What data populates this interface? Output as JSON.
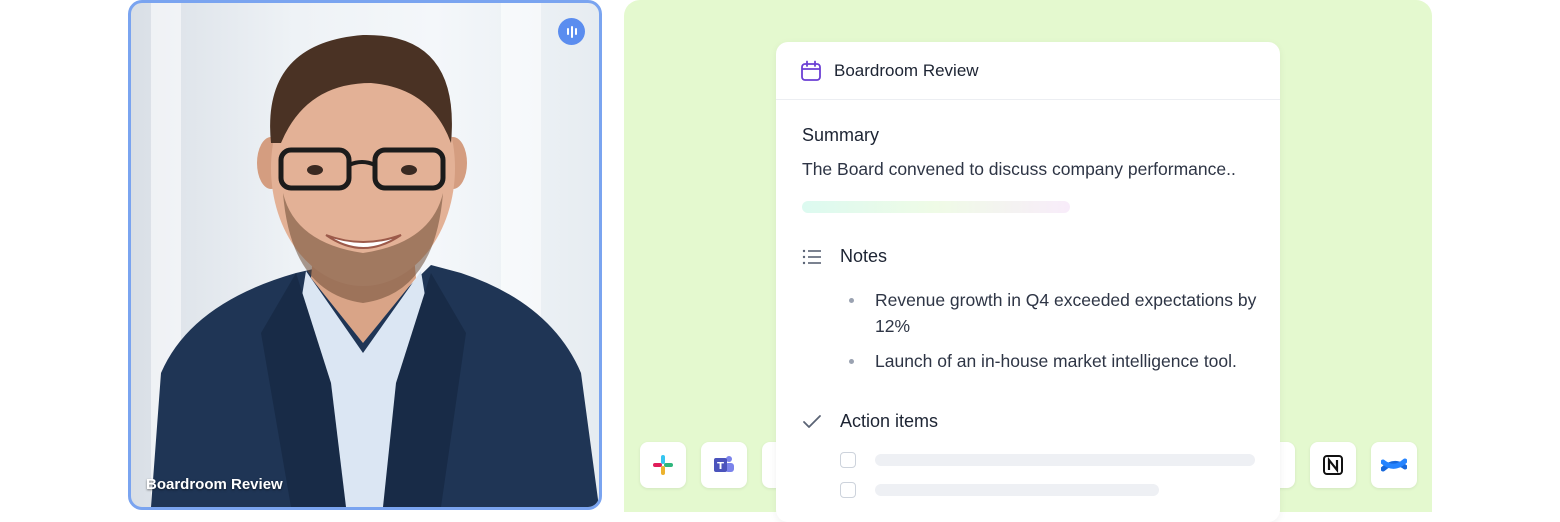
{
  "video": {
    "label": "Boardroom Review",
    "audio_icon": "audio-wave-icon",
    "border_color": "#7aa4f0"
  },
  "panel": {
    "background": "#e4f9cf",
    "app_icons": [
      "slack-icon",
      "teams-icon",
      "notion-icon",
      "confluence-icon"
    ]
  },
  "card": {
    "title": "Boardroom Review",
    "title_icon": "calendar-icon",
    "summary_label": "Summary",
    "summary_text": "The Board convened to discuss company performance..",
    "notes_label": "Notes",
    "notes_icon": "list-icon",
    "notes": [
      "Revenue growth in Q4 exceeded expectations by 12%",
      "Launch of an in-house market intelligence tool."
    ],
    "action_items_label": "Action items",
    "action_items_icon": "check-icon"
  }
}
